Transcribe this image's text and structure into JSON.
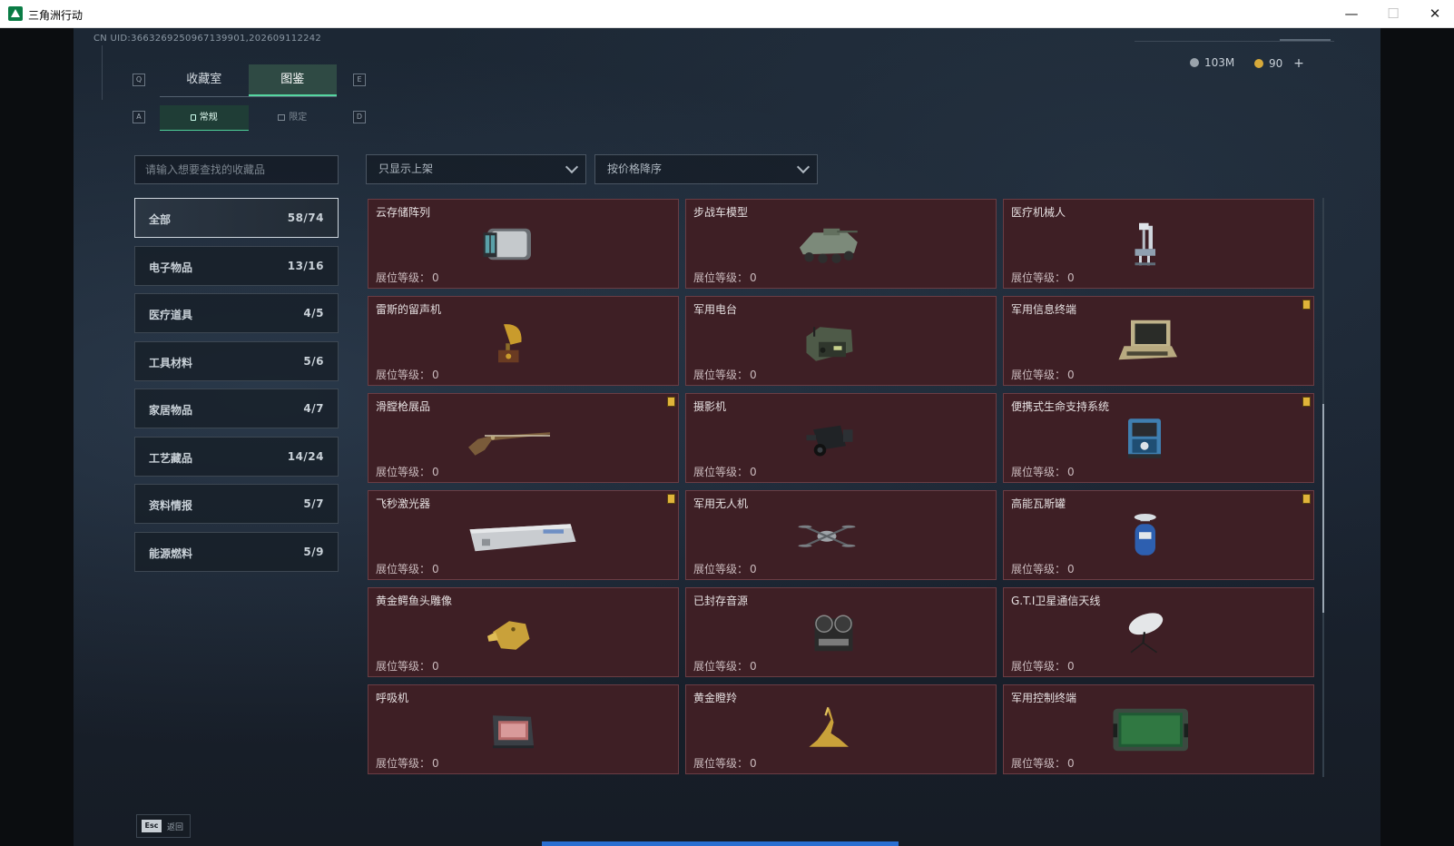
{
  "window": {
    "title": "三角洲行动",
    "minimize": "—",
    "maximize": "☐",
    "close": "✕"
  },
  "uid": "CN UID:3663269250967139901,202609112242",
  "currency": [
    {
      "icon": "silver-coin-icon",
      "value": "103M",
      "color": "#9aa3ab"
    },
    {
      "icon": "gold-coin-icon",
      "value": "90",
      "color": "#d6a93a",
      "add": "+"
    }
  ],
  "key_hints": {
    "prev_tab": "Q",
    "next_tab": "E",
    "prev_sub": "A",
    "next_sub": "D"
  },
  "tabs": [
    {
      "label": "收藏室",
      "active": false
    },
    {
      "label": "图鉴",
      "active": true
    }
  ],
  "subtabs": [
    {
      "label": "常规",
      "icon": "lock-icon",
      "active": true
    },
    {
      "label": "限定",
      "icon": "box-icon",
      "active": false
    }
  ],
  "search": {
    "placeholder": "请输入想要查找的收藏品",
    "value": ""
  },
  "filters": {
    "shelf": "只显示上架",
    "sort": "按价格降序"
  },
  "categories": [
    {
      "label": "全部",
      "count": "58/74",
      "active": true
    },
    {
      "label": "电子物品",
      "count": "13/16"
    },
    {
      "label": "医疗道具",
      "count": "4/5"
    },
    {
      "label": "工具材料",
      "count": "5/6"
    },
    {
      "label": "家居物品",
      "count": "4/7"
    },
    {
      "label": "工艺藏品",
      "count": "14/24"
    },
    {
      "label": "资料情报",
      "count": "5/7"
    },
    {
      "label": "能源燃料",
      "count": "5/9"
    }
  ],
  "level_label": "展位等级：",
  "items": [
    {
      "name": "云存储阵列",
      "level": "0",
      "flag": false,
      "icon": "server-array-icon"
    },
    {
      "name": "步战车模型",
      "level": "0",
      "flag": false,
      "icon": "armored-vehicle-icon"
    },
    {
      "name": "医疗机械人",
      "level": "0",
      "flag": false,
      "icon": "medical-robot-icon"
    },
    {
      "name": "雷斯的留声机",
      "level": "0",
      "flag": false,
      "icon": "gramophone-icon"
    },
    {
      "name": "军用电台",
      "level": "0",
      "flag": false,
      "icon": "military-radio-icon"
    },
    {
      "name": "军用信息终端",
      "level": "0",
      "flag": true,
      "icon": "info-terminal-icon"
    },
    {
      "name": "滑膛枪展品",
      "level": "0",
      "flag": true,
      "icon": "musket-icon"
    },
    {
      "name": "摄影机",
      "level": "0",
      "flag": false,
      "icon": "camera-icon"
    },
    {
      "name": "便携式生命支持系统",
      "level": "0",
      "flag": true,
      "icon": "life-support-icon"
    },
    {
      "name": "飞秒激光器",
      "level": "0",
      "flag": true,
      "icon": "laser-case-icon"
    },
    {
      "name": "军用无人机",
      "level": "0",
      "flag": false,
      "icon": "drone-icon"
    },
    {
      "name": "高能瓦斯罐",
      "level": "0",
      "flag": true,
      "icon": "gas-tank-icon"
    },
    {
      "name": "黄金鳄鱼头雕像",
      "level": "0",
      "flag": false,
      "icon": "gold-crocodile-icon"
    },
    {
      "name": "已封存音源",
      "level": "0",
      "flag": false,
      "icon": "tape-recorder-icon"
    },
    {
      "name": "G.T.I卫星通信天线",
      "level": "0",
      "flag": false,
      "icon": "satellite-dish-icon"
    },
    {
      "name": "呼吸机",
      "level": "0",
      "flag": false,
      "icon": "ventilator-icon"
    },
    {
      "name": "黄金瞪羚",
      "level": "0",
      "flag": false,
      "icon": "gold-gazelle-icon"
    },
    {
      "name": "军用控制终端",
      "level": "0",
      "flag": false,
      "icon": "control-terminal-icon"
    }
  ],
  "back": {
    "key": "Esc",
    "label": "返回"
  }
}
